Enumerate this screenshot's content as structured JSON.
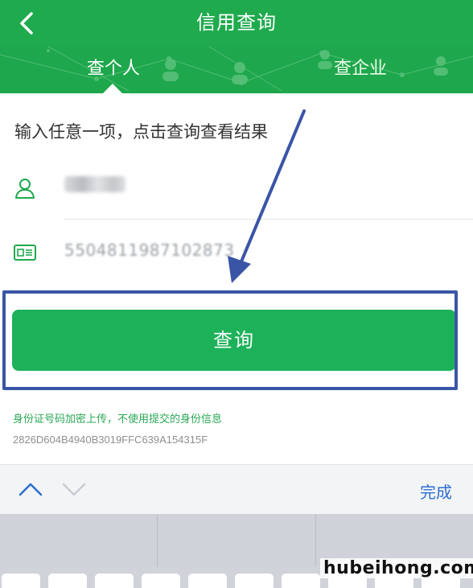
{
  "header": {
    "title": "信用查询",
    "back_icon": "chevron-left-icon"
  },
  "tabs": [
    {
      "label": "查个人",
      "selected": true
    },
    {
      "label": "查企业",
      "selected": false
    }
  ],
  "form": {
    "instruction": "输入任意一项，点击查询查看结果",
    "name_field": {
      "icon": "person-icon",
      "value": ""
    },
    "id_field": {
      "icon": "id-card-icon",
      "value": "5504811987102873"
    },
    "submit_label": "查询"
  },
  "notes": {
    "privacy": "身份证号码加密上传，不使用提交的身份信息",
    "hash": "2826D604B4940B3019FFC639A154315F"
  },
  "keyboard": {
    "done_label": "完成",
    "up_icon": "chevron-up-icon",
    "down_icon": "chevron-down-icon"
  },
  "watermark": "hubeihong.com",
  "colors": {
    "primary": "#1faa4e",
    "button": "#1db15a",
    "annotation": "#3a55a6",
    "link": "#2d6fd1"
  }
}
